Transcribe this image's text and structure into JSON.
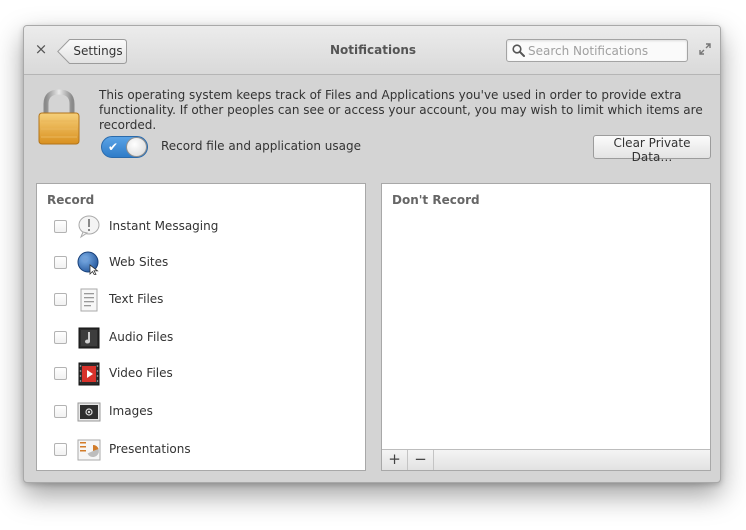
{
  "window": {
    "title": "Notifications",
    "back_label": "Settings",
    "close_glyph": "×"
  },
  "search": {
    "placeholder": "Search Notifications",
    "value": ""
  },
  "privacy": {
    "description": "This operating system keeps track of Files and Applications you've used in order to provide extra functionality. If other peoples can see or access your account, you may wish to limit which items are recorded.",
    "toggle_label": "Record file and application usage",
    "toggle_on": true,
    "clear_button": "Clear Private Data…"
  },
  "record_panel": {
    "title": "Record",
    "items": [
      {
        "label": "Instant Messaging",
        "icon": "instant-messaging-icon",
        "checked": false
      },
      {
        "label": "Web Sites",
        "icon": "web-sites-icon",
        "checked": false
      },
      {
        "label": "Text Files",
        "icon": "text-files-icon",
        "checked": false
      },
      {
        "label": "Audio Files",
        "icon": "audio-files-icon",
        "checked": false
      },
      {
        "label": "Video Files",
        "icon": "video-files-icon",
        "checked": false
      },
      {
        "label": "Images",
        "icon": "images-icon",
        "checked": false
      },
      {
        "label": "Presentations",
        "icon": "presentations-icon",
        "checked": false
      }
    ]
  },
  "dont_record_panel": {
    "title": "Don't Record",
    "items": [],
    "add_glyph": "+",
    "remove_glyph": "−"
  },
  "colors": {
    "accent": "#3a86d2",
    "window_bg": "#d4d4d4"
  }
}
